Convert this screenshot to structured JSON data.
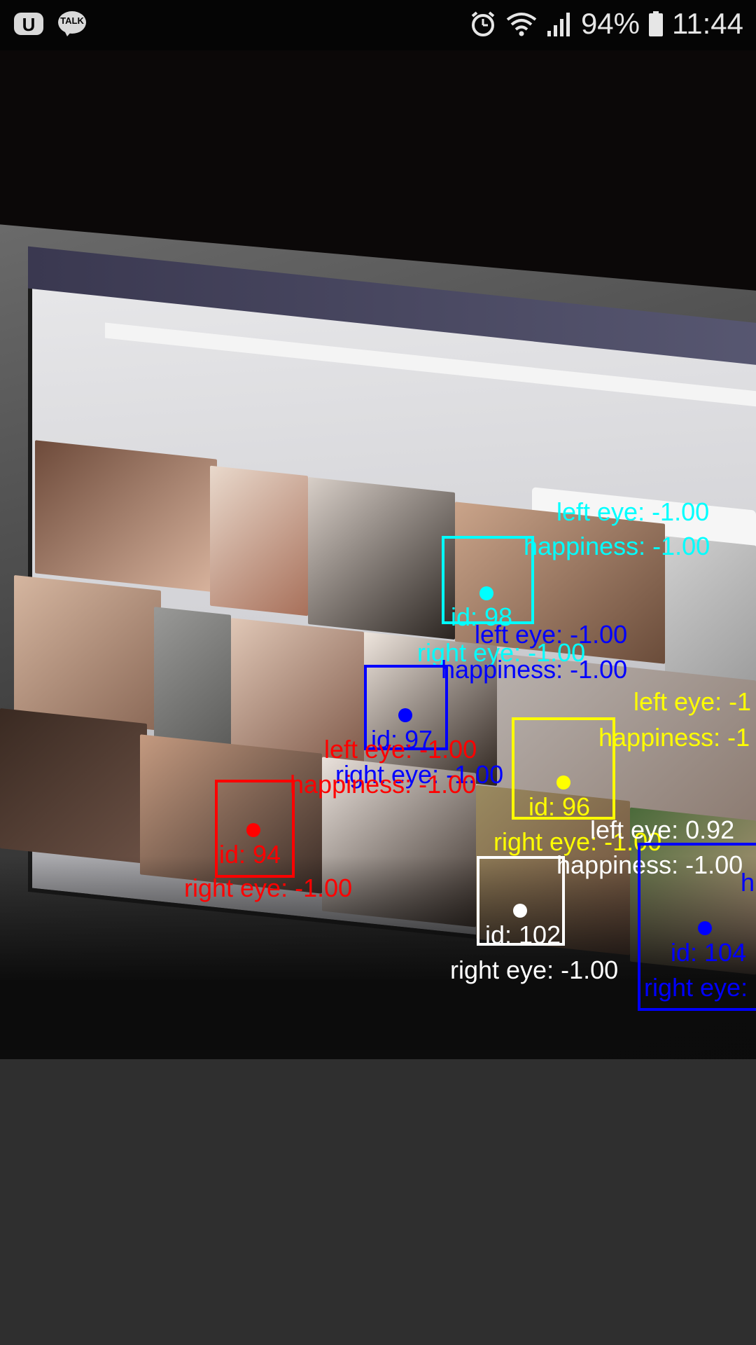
{
  "status_bar": {
    "left_icons": [
      "u-plus-icon",
      "kakaotalk-icon"
    ],
    "kakaotalk_label": "TALK",
    "battery_percent": "94%",
    "time": "11:44",
    "right_icons": [
      "alarm-icon",
      "wifi-icon",
      "signal-icon",
      "battery-icon"
    ]
  },
  "faces": [
    {
      "id_label": "id: 98",
      "color": "#00ffff",
      "left_eye": "left eye: -1.00",
      "happiness": "happiness: -1.00",
      "right_eye": "right eye: -1.00"
    },
    {
      "id_label": "id: 97",
      "color": "#0000ff",
      "left_eye": "left eye: -1.00",
      "happiness": "happiness: -1.00",
      "right_eye": "right eye: -1.00"
    },
    {
      "id_label": "id: 96",
      "color": "#ffff00",
      "left_eye": "left eye: -1",
      "happiness": "happiness: -1",
      "right_eye": "right eye: -1.00"
    },
    {
      "id_label": "id: 94",
      "color": "#ff0000",
      "left_eye": "left eye: -1.00",
      "happiness": "happiness: -1.00",
      "right_eye": "right eye: -1.00"
    },
    {
      "id_label": "id: 102",
      "color": "#ffffff",
      "left_eye": "left eye: 0.92",
      "happiness": "happiness: -1.00",
      "right_eye": "right eye: -1.00"
    },
    {
      "id_label": "id: 104",
      "color": "#0000ff",
      "happiness": "h",
      "right_eye": "right eye:"
    }
  ]
}
